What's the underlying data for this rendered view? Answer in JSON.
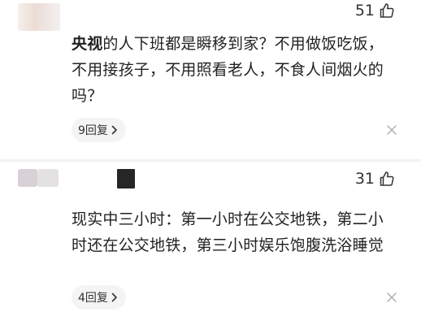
{
  "comments": [
    {
      "likes": "51",
      "mention": "央视",
      "text": "的人下班都是瞬移到家？不用做饭吃饭，不用接孩子，不用照看老人，不食人间烟火的吗？",
      "replies_label": "9回复"
    },
    {
      "likes": "31",
      "mention": "",
      "text": "现实中三小时：第一小时在公交地铁，第二小时还在公交地铁，第三小时娱乐饱腹洗浴睡觉",
      "replies_label": "4回复"
    }
  ],
  "icons": {
    "like": "thumbs-up-icon",
    "replies_expand": "chevron-right-icon",
    "dismiss": "close-icon"
  },
  "colors": {
    "text": "#222222",
    "muted": "#333333",
    "pill_bg": "#f4f4f4",
    "divider": "#f2f2f2",
    "close_gray": "#aaaaaa"
  }
}
